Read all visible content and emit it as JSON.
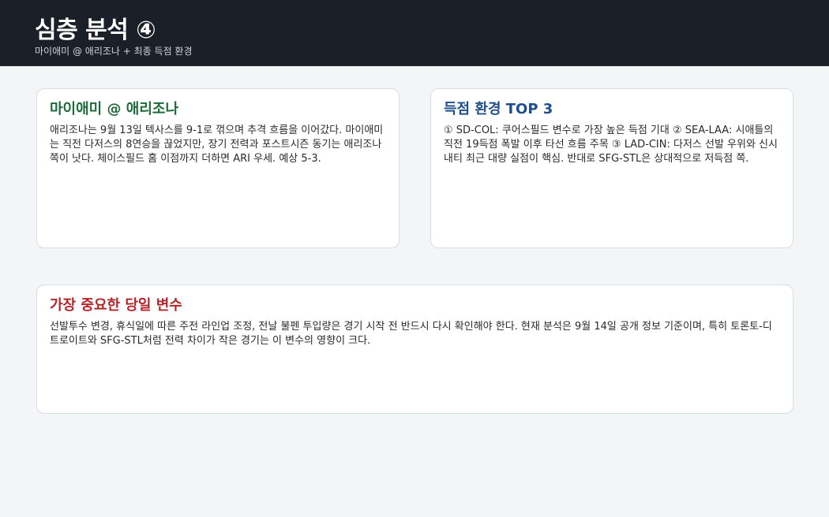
{
  "header": {
    "title": "심층 분석 ④",
    "subtitle": "마이애미 @ 애리조나 + 최종 득점 환경"
  },
  "cards": [
    {
      "title": "마이애미 @ 애리조나",
      "title_color": "#1e6b3a",
      "body": "애리조나는 9월 13일 텍사스를 9-1로 꺾으며 추격 흐름을 이어갔다. 마이애미는 직전 다저스의 8연승을 끊었지만, 장기 전력과 포스트시즌 동기는 애리조나 쪽이 낫다. 체이스필드 홈 이점까지 더하면 ARI 우세. 예상 5-3."
    },
    {
      "title": "득점 환경 TOP 3",
      "title_color": "#1f4f8a",
      "body": "① SD-COL: 쿠어스필드 변수로 가장 높은 득점 기대 ② SEA-LAA: 시애틀의 직전 19득점 폭발 이후 타선 흐름 주목 ③ LAD-CIN: 다저스 선발 우위와 신시내티 최근 대량 실점이 핵심. 반대로 SFG-STL은 상대적으로 저득점 쪽."
    },
    {
      "title": "가장 중요한 당일 변수",
      "title_color": "#b3262b",
      "body": "선발투수 변경, 휴식일에 따른 주전 라인업 조정, 전날 불펜 투입량은 경기 시작 전 반드시 다시 확인해야 한다. 현재 분석은 9월 14일 공개 정보 기준이며, 특히 토론토-디트로이트와 SFG-STL처럼 전력 차이가 작은 경기는 이 변수의 영향이 크다."
    }
  ]
}
